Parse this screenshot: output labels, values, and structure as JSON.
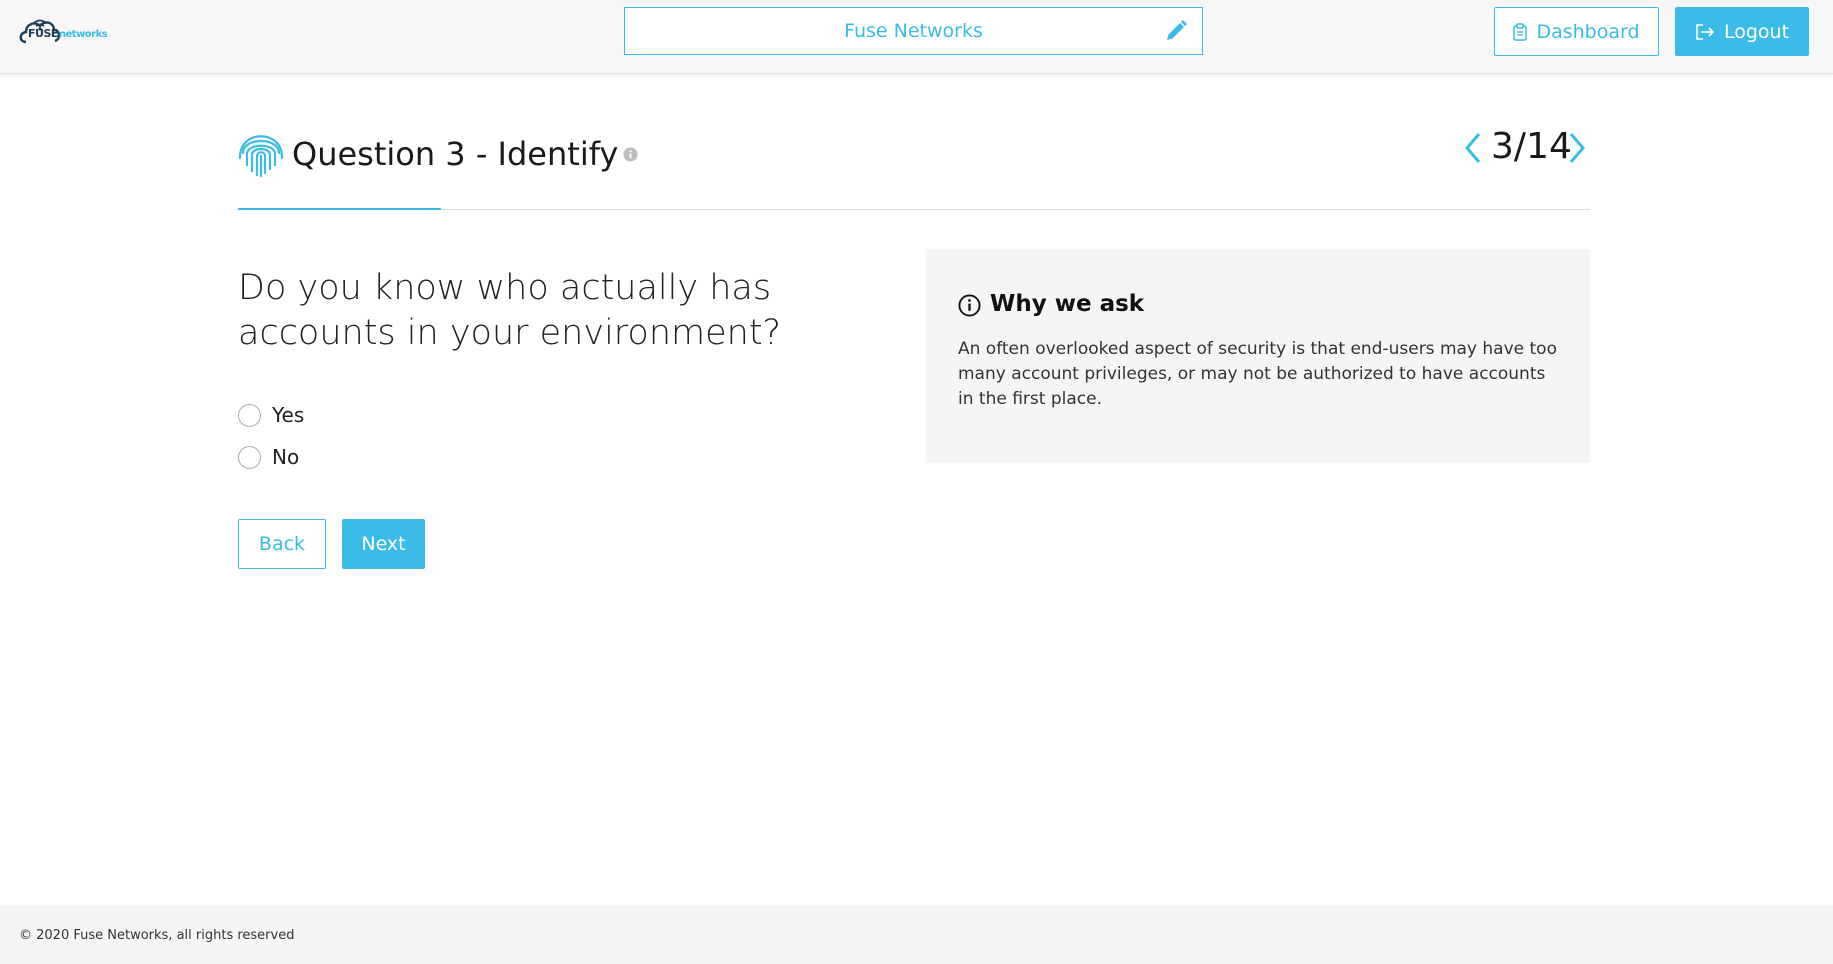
{
  "header": {
    "logo": {
      "brand_main": "FUSE",
      "brand_sub": "networks"
    },
    "company_name": "Fuse Networks",
    "edit_icon": "pencil-icon",
    "dashboard_label": "Dashboard",
    "dashboard_icon": "clipboard-icon",
    "logout_label": "Logout",
    "logout_icon": "logout-icon"
  },
  "question": {
    "title": "Question 3 - Identify",
    "icon": "fingerprint-icon",
    "pager": "3/14",
    "text": "Do you know who actually has accounts in your environment?",
    "options": [
      {
        "label": "Yes"
      },
      {
        "label": "No"
      }
    ],
    "back_label": "Back",
    "next_label": "Next"
  },
  "why": {
    "title": "Why we ask",
    "text": "An often overlooked aspect of security is that end-users may have too many account privileges, or may not be authorized to have accounts in the first place."
  },
  "footer": {
    "copyright": "© 2020 Fuse Networks, all rights reserved"
  },
  "colors": {
    "accent": "#3bbbe8",
    "header_bg": "#f7f7f7",
    "panel_bg": "#f5f5f5"
  }
}
